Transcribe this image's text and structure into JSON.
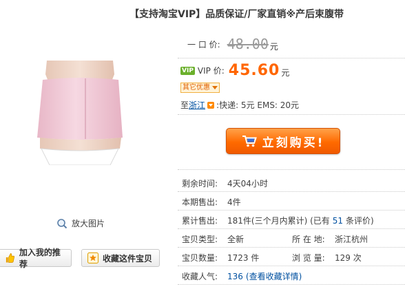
{
  "product": {
    "title": "【支持淘宝VIP】品质保证/厂家直销※产后束腹带",
    "image_alt": "产后束腹带"
  },
  "gallery": {
    "zoom_label": "放大图片"
  },
  "actions": {
    "recommend_label": "加入我的推荐",
    "favorite_label": "收藏这件宝贝"
  },
  "price": {
    "fixed_label": "一 口 价:",
    "fixed_value": "48.00",
    "fixed_unit": "元",
    "vip_badge": "VIP",
    "vip_label": "VIP 价:",
    "vip_value": "45.60",
    "vip_unit": "元",
    "promo_label": "其它优惠"
  },
  "shipping": {
    "to_label": "至",
    "destination": "浙江",
    "rates": ":快递: 5元   EMS: 20元"
  },
  "buy": {
    "label": "立刻购买!"
  },
  "stats": {
    "time_left_label": "剩余时间:",
    "time_left_value": "4天04小时",
    "sold_period_label": "本期售出:",
    "sold_period_value": "4件",
    "sold_total_label": "累计售出:",
    "sold_total_value": "181件(三个月内累计) (已有",
    "review_count": "51",
    "review_suffix": "条评价)",
    "type_label": "宝贝类型:",
    "type_value": "全新",
    "location_label": "所 在 地:",
    "location_value": "浙江杭州",
    "quantity_label": "宝贝数量:",
    "quantity_value": "1723 件",
    "views_label": "浏 览 量:",
    "views_value": "129 次",
    "favorites_label": "收藏人气:",
    "favorites_value": "136",
    "favorites_link": "(查看收藏详情)"
  },
  "colors": {
    "price_orange": "#ff6600",
    "link_blue": "#0050a0",
    "vip_green": "#6bb02c"
  }
}
